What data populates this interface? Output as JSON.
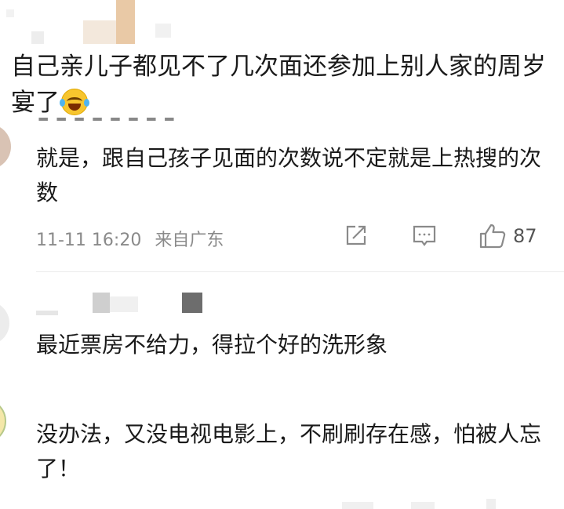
{
  "quoted_comment": {
    "text": "自己亲儿子都见不了几次面还参加上别人家的周岁宴了",
    "emoji_icon": "laughing-crying-face-icon"
  },
  "reply": {
    "text": "就是，跟自己孩子见面的次数说不定就是上热搜的次数",
    "time": "11-11 16:20",
    "location": "来自广东",
    "like_count": "87"
  },
  "comments": [
    {
      "text": "最近票房不给力，得拉个好的洗形象"
    },
    {
      "text": "没办法，又没电视电影上，不刷刷存在感，怕被人忘了！"
    }
  ],
  "icons": {
    "share": "share-icon",
    "comment": "comment-icon",
    "like": "thumbs-up-icon"
  }
}
